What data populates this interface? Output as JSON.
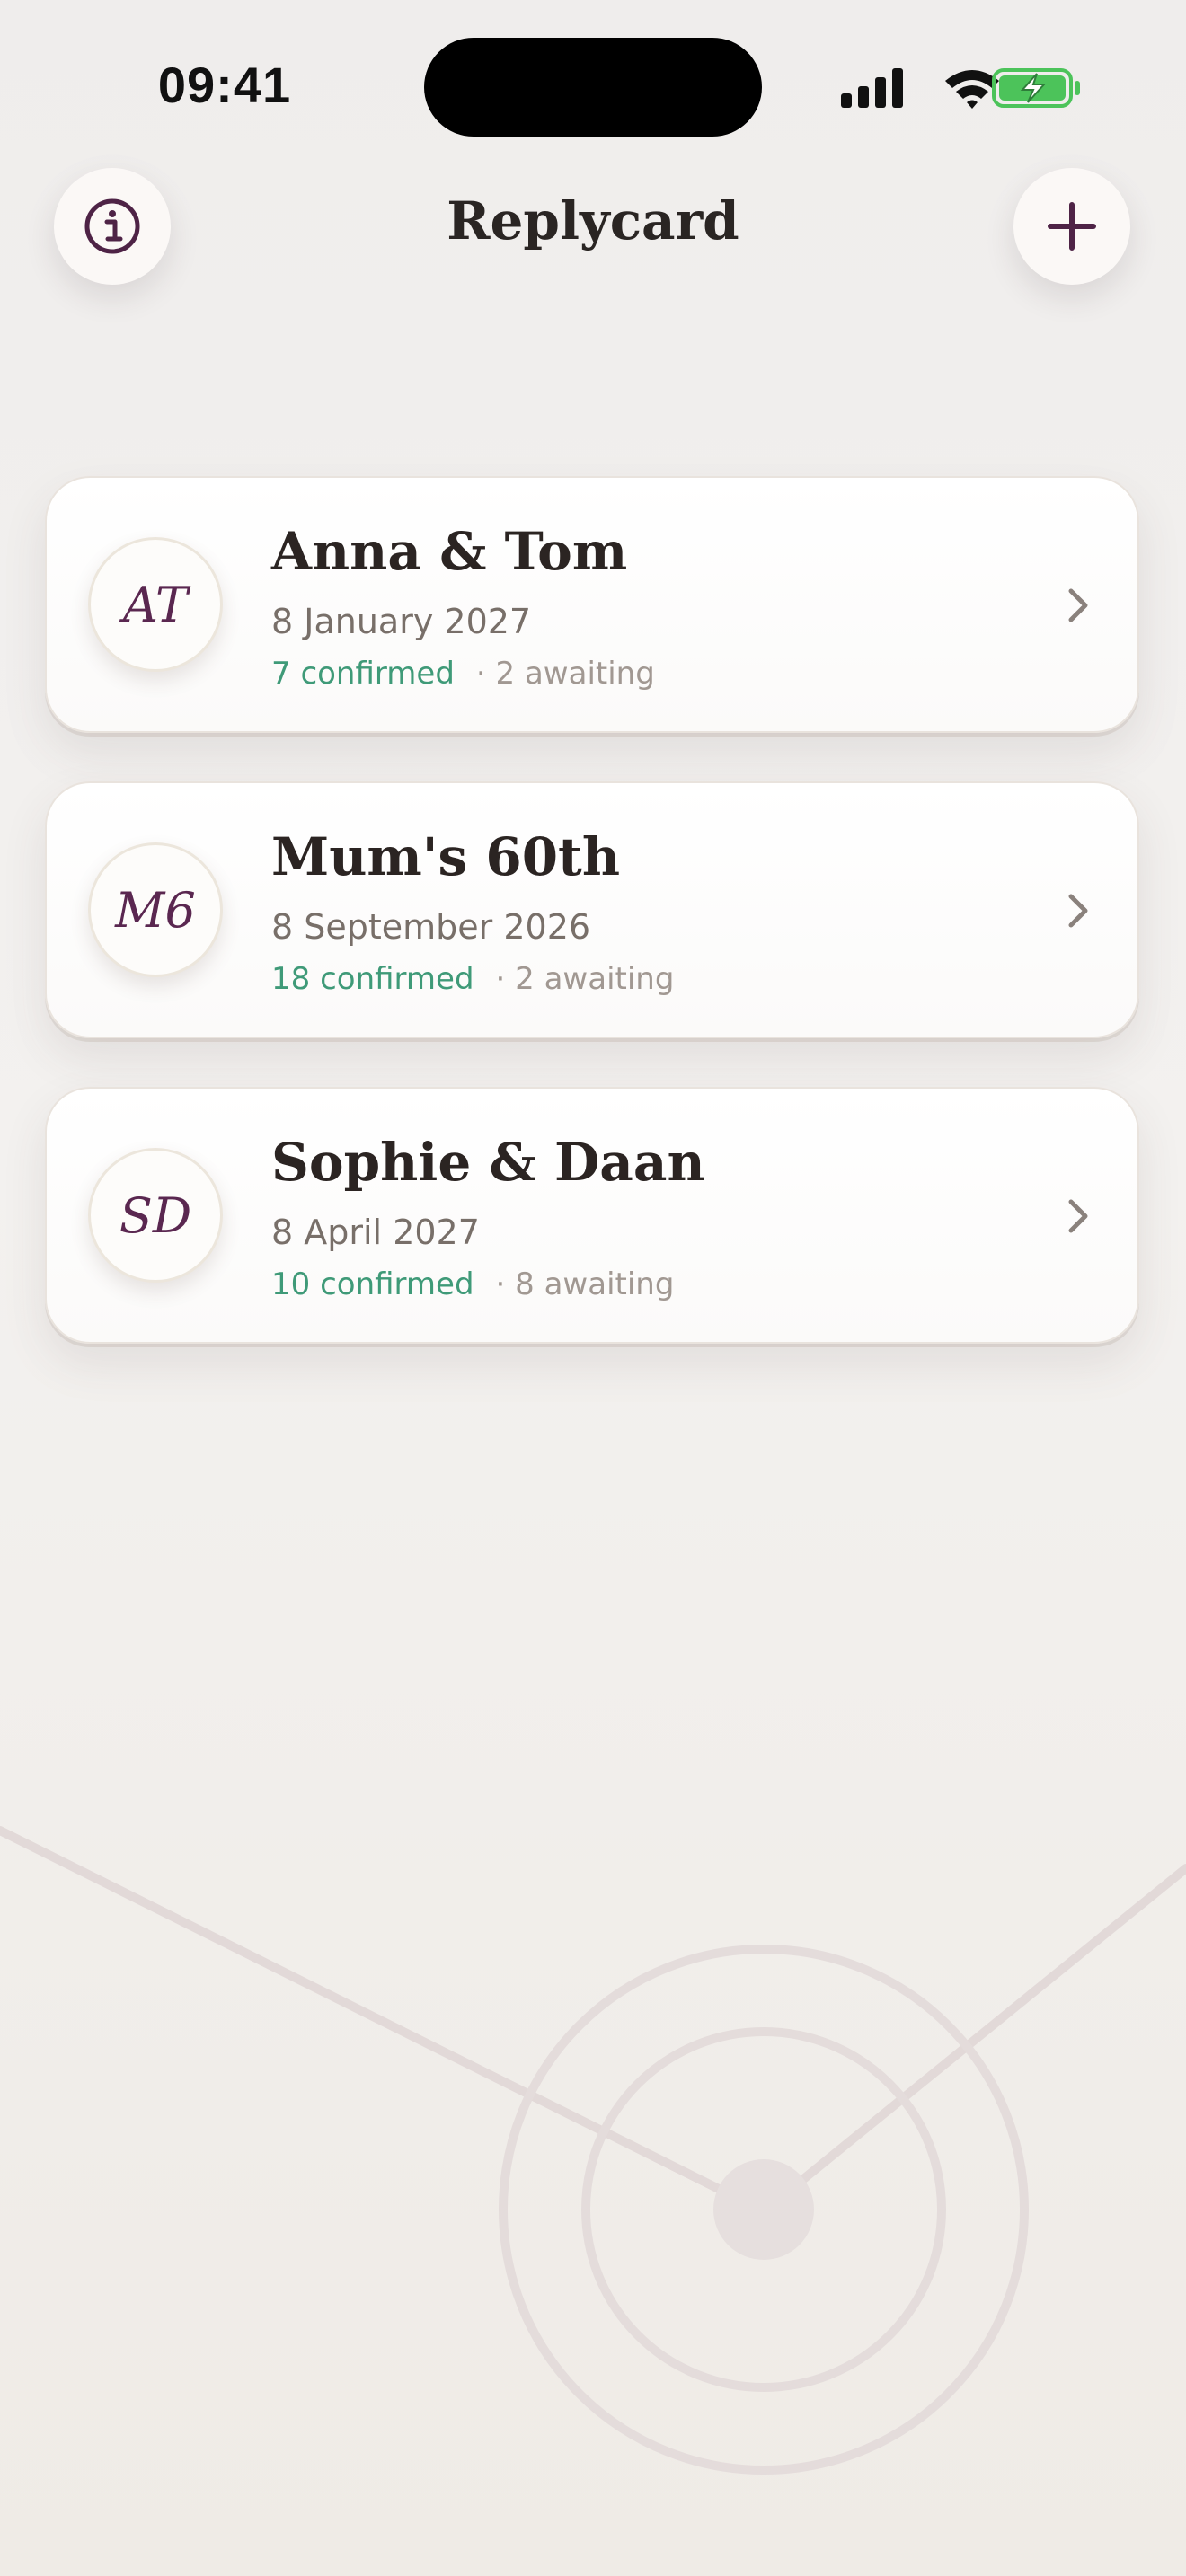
{
  "status_bar": {
    "time": "09:41"
  },
  "header": {
    "title": "Replycard",
    "info_icon": "info-icon",
    "add_icon": "plus-icon"
  },
  "events": [
    {
      "initials": "AT",
      "title": "Anna & Tom",
      "date": "8 January 2027",
      "confirmed": "7 confirmed",
      "awaiting": "· 2 awaiting"
    },
    {
      "initials": "M6",
      "title": "Mum's 60th",
      "date": "8 September 2026",
      "confirmed": "18 confirmed",
      "awaiting": "· 2 awaiting"
    },
    {
      "initials": "SD",
      "title": "Sophie & Daan",
      "date": "8 April 2027",
      "confirmed": "10 confirmed",
      "awaiting": "· 8 awaiting"
    }
  ],
  "colors": {
    "accent": "#5a2750",
    "confirmed": "#3f9a78",
    "awaiting": "#a19892",
    "battery": "#4cc35a"
  }
}
